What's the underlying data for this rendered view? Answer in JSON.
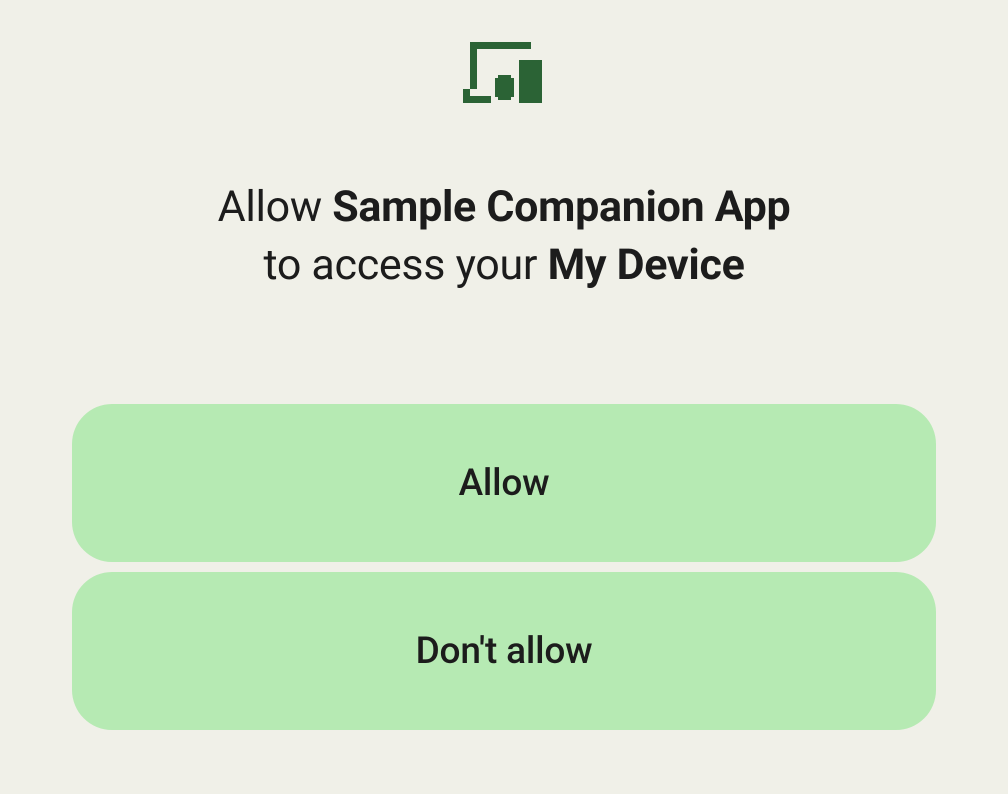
{
  "dialog": {
    "title_parts": {
      "prefix": "Allow ",
      "app_name": "Sample Companion App",
      "middle": " to access your ",
      "device_name": "My Device"
    },
    "buttons": {
      "allow_label": "Allow",
      "deny_label": "Don't allow"
    }
  },
  "icon": {
    "color": "#2b6335"
  }
}
